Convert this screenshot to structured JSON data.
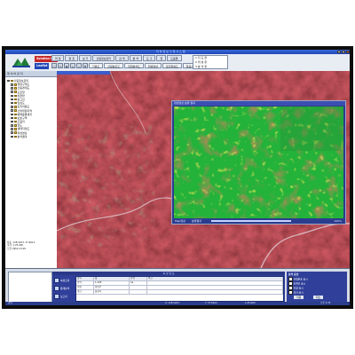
{
  "window": {
    "title": "지 하 정 보 구 축 시 스 템",
    "controls": [
      "_",
      "□",
      "×"
    ]
  },
  "brand": {
    "name_top": "Solution Pro",
    "name_bottom": "Leaflet"
  },
  "menu": {
    "items": [
      "파 일",
      "편 집",
      "보 기",
      "산림정보관리",
      "검 색",
      "분 석",
      "도 구",
      "창",
      "도움말"
    ]
  },
  "toolbar": {
    "tabs": [
      "기본도",
      "산림분포도",
      "지형분석도",
      "위성영상",
      "토지피복도",
      "항공사진"
    ]
  },
  "status_box": {
    "lines": [
      "1 지 도 창",
      "2 위 성 창",
      "3 분 석 창"
    ]
  },
  "sidebar": {
    "header": "레 이 어 관 리",
    "items": [
      {
        "label": "산림정보관리",
        "level": 0,
        "expanded": true
      },
      {
        "label": "행정구역도",
        "level": 1
      },
      {
        "label": "산림경계도",
        "level": 1
      },
      {
        "label": "도로망",
        "level": 1
      },
      {
        "label": "하천망",
        "level": 1
      },
      {
        "label": "등고선",
        "level": 1
      },
      {
        "label": "임상도",
        "level": 1
      },
      {
        "label": "토지이용도",
        "level": 1
      },
      {
        "label": "산불위험지역",
        "level": 1
      },
      {
        "label": "병해충발생지",
        "level": 1
      },
      {
        "label": "보호구역",
        "level": 1
      },
      {
        "label": "조림지",
        "level": 1
      },
      {
        "label": "임도",
        "level": 1
      },
      {
        "label": "생태자연도",
        "level": 1
      },
      {
        "label": "위성영상",
        "level": 1
      },
      {
        "label": "분석결과",
        "level": 1
      }
    ],
    "status_lines": [
      "좌표: 128.5203, 37.6612",
      "축척: 1:25,000",
      "도엽: NJ52-13-09"
    ]
  },
  "satellite_window": {
    "title": "위성영상 분류 결과",
    "footer_left": "Map영상",
    "footer_mid": "분류결과",
    "footer_right": "100%"
  },
  "bottom": {
    "middle_header": "속 성 정 보",
    "function_buttons": [
      "속성조회",
      "통계분석",
      "보고서"
    ],
    "table": {
      "headers": [
        "항목",
        "값",
        "단위",
        "비고"
      ],
      "rows": [
        [
          "면적",
          "1,245",
          "ha",
          ""
        ],
        [
          "임상",
          "침엽수",
          "",
          ""
        ],
        [
          "경급",
          "중경목",
          "",
          ""
        ]
      ]
    },
    "right_panel": {
      "title": "분석 옵션",
      "options": [
        "산림분포 표시",
        "경계선 표시",
        "지명 표시",
        "격자 표시"
      ],
      "buttons": [
        "적용",
        "취소"
      ]
    }
  },
  "status_bar": {
    "segments": [
      "준비",
      "X: 128.5203",
      "Y: 37.6612",
      "1:25,000",
      "오후 2:35"
    ]
  },
  "colors": {
    "title_blue": "#2a46b5",
    "panel_blue": "#30409a",
    "terrain_red": "#7b1e22",
    "forest_green": "#22b13a",
    "brown": "#7a3a18",
    "yellow": "#e8d218"
  }
}
